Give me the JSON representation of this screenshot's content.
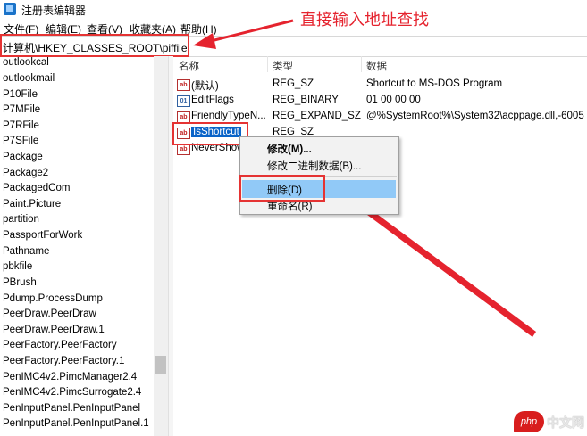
{
  "window": {
    "title": "注册表编辑器"
  },
  "menu": [
    "文件(F)",
    "编辑(E)",
    "查看(V)",
    "收藏夹(A)",
    "帮助(H)"
  ],
  "address": {
    "path": "计算机\\HKEY_CLASSES_ROOT\\piffile"
  },
  "annotation": {
    "text": "直接输入地址查找"
  },
  "tree": {
    "items": [
      "outlookcal",
      "outlookmail",
      "P10File",
      "P7MFile",
      "P7RFile",
      "P7SFile",
      "Package",
      "Package2",
      "PackagedCom",
      "Paint.Picture",
      "partition",
      "PassportForWork",
      "Pathname",
      "pbkfile",
      "PBrush",
      "Pdump.ProcessDump",
      "PeerDraw.PeerDraw",
      "PeerDraw.PeerDraw.1",
      "PeerFactory.PeerFactory",
      "PeerFactory.PeerFactory.1",
      "PenIMC4v2.PimcManager2.4",
      "PenIMC4v2.PimcSurrogate2.4",
      "PenInputPanel.PenInputPanel",
      "PenInputPanel.PenInputPanel.1"
    ]
  },
  "columns": {
    "name": "名称",
    "type": "类型",
    "data": "数据"
  },
  "values": [
    {
      "icon": "string-value-icon",
      "name": "(默认)",
      "type": "REG_SZ",
      "data": "Shortcut to MS-DOS Program"
    },
    {
      "icon": "binary-value-icon",
      "name": "EditFlags",
      "type": "REG_BINARY",
      "data": "01 00 00 00"
    },
    {
      "icon": "string-value-icon",
      "name": "FriendlyTypeN...",
      "type": "REG_EXPAND_SZ",
      "data": "@%SystemRoot%\\System32\\acppage.dll,-6005"
    },
    {
      "icon": "string-value-icon",
      "name": "IsShortcut",
      "type": "REG_SZ",
      "data": ""
    },
    {
      "icon": "string-value-icon",
      "name": "NeverShow...",
      "type": "",
      "data": ""
    }
  ],
  "context_menu": {
    "modify": "修改(M)...",
    "modify_binary": "修改二进制数据(B)...",
    "delete": "删除(D)",
    "rename": "重命名(R)"
  },
  "watermark": {
    "logo": "php",
    "text": "中文网"
  },
  "colors": {
    "annotation_red": "#e5232e",
    "selection_blue": "#0a64c8",
    "menu_highlight": "#91c9f7"
  }
}
